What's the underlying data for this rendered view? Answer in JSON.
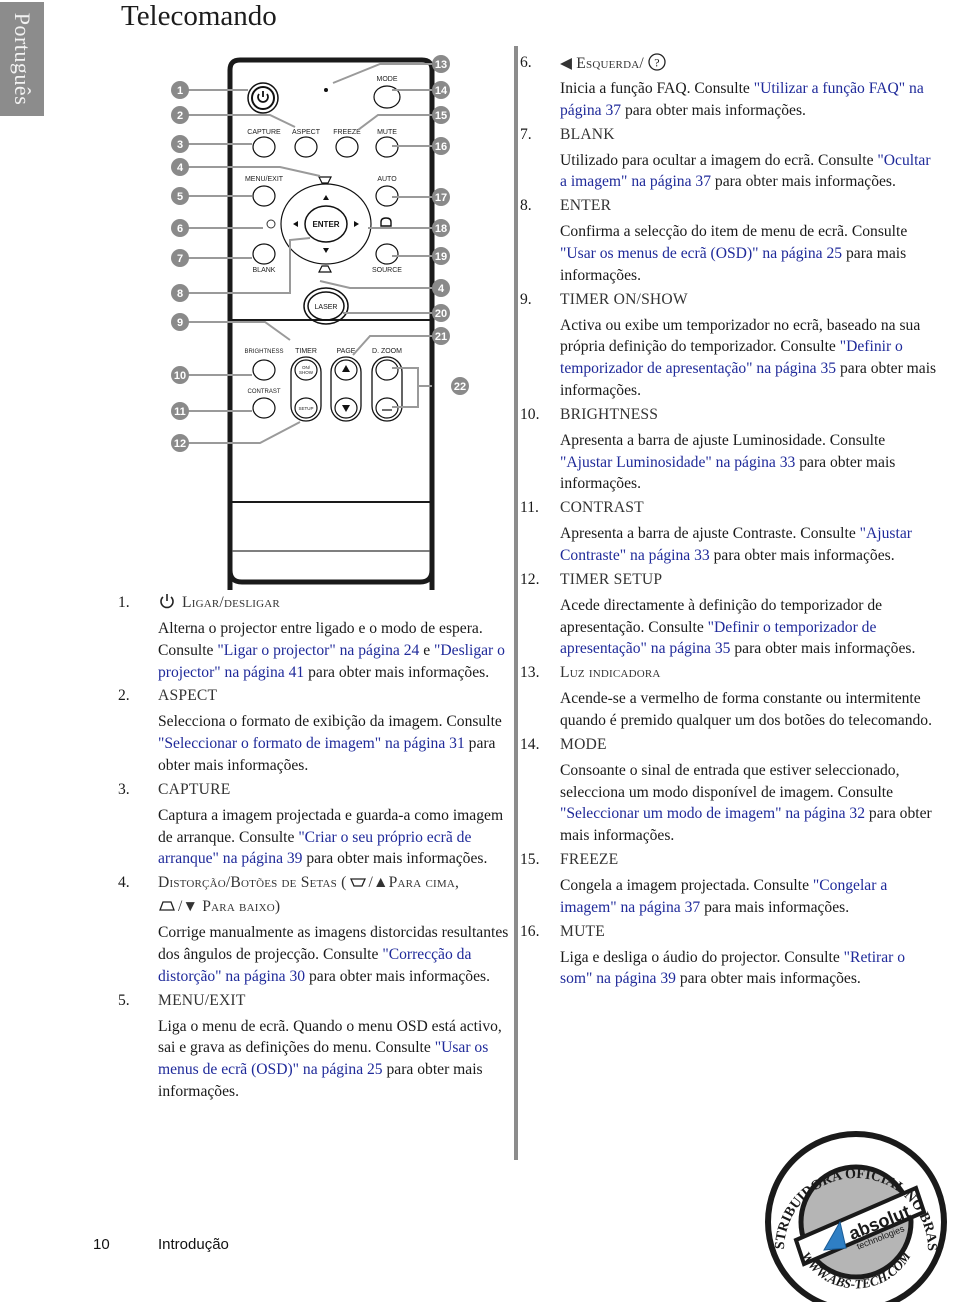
{
  "side_tab": {
    "label": "Português"
  },
  "page_title": "Telecomando",
  "remote": {
    "button_labels": {
      "mode": "MODE",
      "capture": "CAPTURE",
      "aspect": "ASPECT",
      "freeze": "FREEZE",
      "mute": "MUTE",
      "menu_exit": "MENU/EXIT",
      "auto": "AUTO",
      "enter": "ENTER",
      "blank": "BLANK",
      "source": "SOURCE",
      "laser": "LASER",
      "brightness": "BRIGHTNESS",
      "timer": "TIMER",
      "page": "PAGE",
      "dzoom": "D. ZOOM",
      "contrast": "CONTRAST",
      "on_show": "ON/ SHOW",
      "setup": "SETUP"
    },
    "callouts": [
      "1",
      "2",
      "3",
      "4",
      "5",
      "6",
      "7",
      "8",
      "9",
      "10",
      "11",
      "12",
      "13",
      "14",
      "15",
      "16",
      "17",
      "18",
      "19",
      "4",
      "20",
      "21",
      "22"
    ]
  },
  "left_items": [
    {
      "num": "1.",
      "icon": "power-icon",
      "title": "Ligar/desligar",
      "body": [
        {
          "t": "Alterna o projector entre ligado e o modo de espera. Consulte "
        },
        {
          "t": "\"Ligar o projector\" na página 24",
          "link": true
        },
        {
          "t": " e "
        },
        {
          "t": "\"Desligar o projector\" na página 41",
          "link": true
        },
        {
          "t": " para obter mais informações."
        }
      ]
    },
    {
      "num": "2.",
      "title": "ASPECT",
      "body": [
        {
          "t": "Selecciona o formato de exibição da imagem. Consulte "
        },
        {
          "t": "\"Seleccionar o formato de imagem\" na página 31",
          "link": true
        },
        {
          "t": " para obter mais informações."
        }
      ]
    },
    {
      "num": "3.",
      "title": "CAPTURE",
      "body": [
        {
          "t": "Captura a imagem projectada e guarda-a como imagem de arranque. Consulte "
        },
        {
          "t": "\"Criar o seu próprio ecrã de arranque\" na página 39",
          "link": true
        },
        {
          "t": " para obter mais informações."
        }
      ]
    },
    {
      "num": "4.",
      "title": "Distorção/Botões de Setas (",
      "title_up": "/▲Para cima,",
      "title_down": "/▼ Para baixo)",
      "body": [
        {
          "t": "Corrige manualmente as imagens distorcidas resultantes dos ângulos de projecção. Consulte "
        },
        {
          "t": "\"Correcção da distorção\" na página 30",
          "link": true
        },
        {
          "t": " para obter mais informações."
        }
      ]
    },
    {
      "num": "5.",
      "title": "MENU/EXIT",
      "body": [
        {
          "t": "Liga o menu de ecrã. Quando o menu OSD está activo, sai e grava as definições do menu. Consulte "
        },
        {
          "t": "\"Usar os menus de ecrã (OSD)\" na página 25",
          "link": true
        },
        {
          "t": " para obter mais informações."
        }
      ]
    }
  ],
  "right_items": [
    {
      "num": "6.",
      "title": "◀ Esquerda/",
      "icon": "help-icon",
      "body": [
        {
          "t": "Inicia a função FAQ. Consulte "
        },
        {
          "t": "\"Utilizar a função FAQ\" na página 37",
          "link": true
        },
        {
          "t": " para obter mais informações."
        }
      ]
    },
    {
      "num": "7.",
      "title": "BLANK",
      "body": [
        {
          "t": "Utilizado para ocultar a imagem do ecrã. Consulte "
        },
        {
          "t": "\"Ocultar a imagem\" na página 37",
          "link": true
        },
        {
          "t": " para obter mais informações."
        }
      ]
    },
    {
      "num": "8.",
      "title": "ENTER",
      "body": [
        {
          "t": "Confirma a selecção do item de menu de ecrã. Consulte "
        },
        {
          "t": "\"Usar os menus de ecrã (OSD)\" na página 25",
          "link": true
        },
        {
          "t": " para mais informações."
        }
      ]
    },
    {
      "num": "9.",
      "title": "TIMER ON/SHOW",
      "body": [
        {
          "t": "Activa ou exibe um temporizador no ecrã, baseado na sua própria definição do temporizador. Consulte "
        },
        {
          "t": "\"Definir o temporizador de apresentação\" na página 35",
          "link": true
        },
        {
          "t": " para obter mais informações."
        }
      ]
    },
    {
      "num": "10.",
      "title": "BRIGHTNESS",
      "body": [
        {
          "t": "Apresenta a barra de ajuste Luminosidade. Consulte "
        },
        {
          "t": "\"Ajustar Luminosidade\" na página 33",
          "link": true
        },
        {
          "t": " para obter mais informações."
        }
      ]
    },
    {
      "num": "11.",
      "title": "CONTRAST",
      "body": [
        {
          "t": "Apresenta a barra de ajuste Contraste. Consulte "
        },
        {
          "t": "\"Ajustar Contraste\" na página 33",
          "link": true
        },
        {
          "t": " para obter mais informações."
        }
      ]
    },
    {
      "num": "12.",
      "title": "TIMER SETUP",
      "body": [
        {
          "t": "Acede directamente à definição do temporizador de apresentação. Consulte "
        },
        {
          "t": "\"Definir o temporizador de apresentação\" na página 35",
          "link": true
        },
        {
          "t": " para obter mais informações."
        }
      ]
    },
    {
      "num": "13.",
      "title": "Luz indicadora",
      "body": [
        {
          "t": "Acende-se a vermelho de forma constante ou intermitente quando é premido qualquer um dos botões do telecomando."
        }
      ]
    },
    {
      "num": "14.",
      "title": "MODE",
      "body": [
        {
          "t": "Consoante o sinal de entrada que estiver seleccionado, selecciona um modo disponível de imagem. Consulte "
        },
        {
          "t": "\"Seleccionar um modo de imagem\" na página 32",
          "link": true
        },
        {
          "t": " para obter mais informações."
        }
      ]
    },
    {
      "num": "15.",
      "title": "FREEZE",
      "body": [
        {
          "t": "Congela a imagem projectada. Consulte "
        },
        {
          "t": "\"Congelar a imagem\" na página 37",
          "link": true
        },
        {
          "t": " para mais informações."
        }
      ]
    },
    {
      "num": "16.",
      "title": "MUTE",
      "body": [
        {
          "t": "Liga e desliga o áudio do projector. Consulte "
        },
        {
          "t": "\"Retirar o som\" na página 39",
          "link": true
        },
        {
          "t": " para obter mais informações."
        }
      ]
    }
  ],
  "seal": {
    "ring_text": "· DISTRIBUIDORA OFICIAL NO BRASIL ·",
    "brand": "absolut",
    "brand_sub": "technologies",
    "url": "WWW.ABS-TECH.COM"
  },
  "footer": {
    "page_number": "10",
    "section": "Introdução"
  },
  "colors": {
    "link": "#1f2a9a",
    "side_tab": "#8c8c8c",
    "callout": "#8a8a8a"
  }
}
